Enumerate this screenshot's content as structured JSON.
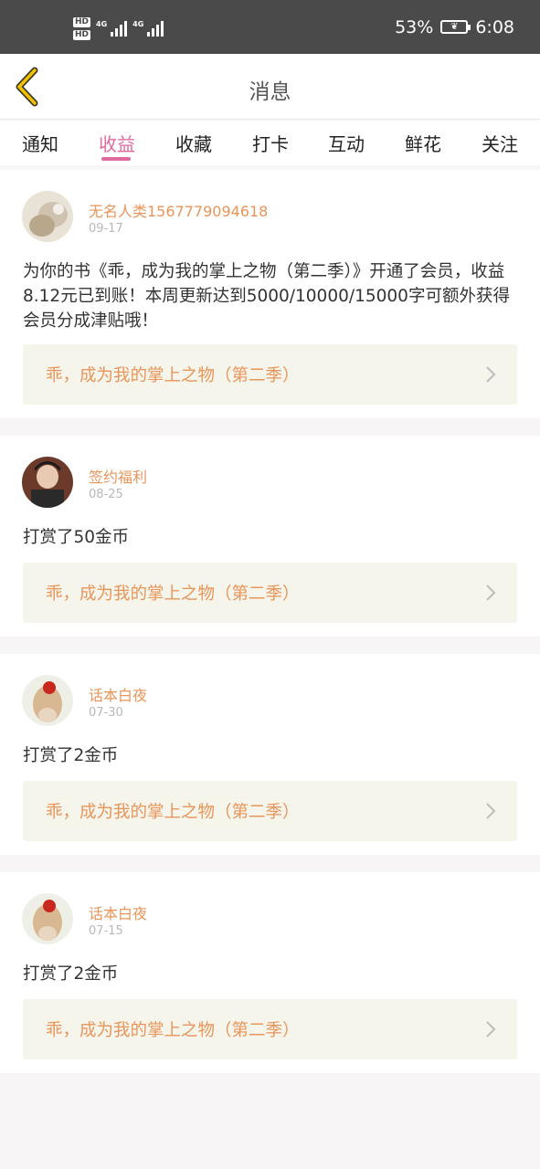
{
  "status_bar": {
    "hd1": "HD",
    "hd2": "HD",
    "net1": "4G",
    "net2": "4G",
    "battery_pct": "53%",
    "time": "6:08",
    "battery_icon": "battery-saver-leaf-icon"
  },
  "header": {
    "title": "消息",
    "back_icon": "chevron-left-icon"
  },
  "tabs": [
    {
      "label": "通知"
    },
    {
      "label": "收益",
      "active": true
    },
    {
      "label": "收藏"
    },
    {
      "label": "打卡"
    },
    {
      "label": "互动"
    },
    {
      "label": "鲜花"
    },
    {
      "label": "关注"
    }
  ],
  "colors": {
    "accent": "#e06aa0",
    "username": "#e8955a",
    "book_bg": "#f6f5ec"
  },
  "messages": [
    {
      "username": "无名人类1567779094618",
      "date": "09-17",
      "text": "为你的书《乖，成为我的掌上之物（第二季）》开通了会员，收益8.12元已到账！本周更新达到5000/10000/15000字可额外获得会员分成津贴哦！",
      "book": "乖，成为我的掌上之物（第二季）"
    },
    {
      "username": "签约福利",
      "date": "08-25",
      "text": "打赏了50金币",
      "book": "乖，成为我的掌上之物（第二季）"
    },
    {
      "username": "话本白夜",
      "date": "07-30",
      "text": "打赏了2金币",
      "book": "乖，成为我的掌上之物（第二季）"
    },
    {
      "username": "话本白夜",
      "date": "07-15",
      "text": "打赏了2金币",
      "book": "乖，成为我的掌上之物（第二季）"
    }
  ]
}
